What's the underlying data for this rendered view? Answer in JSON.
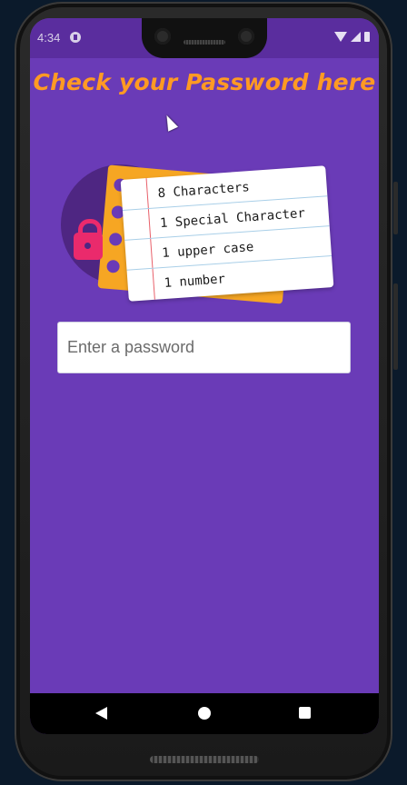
{
  "status_bar": {
    "time": "4:34",
    "app_icon": "app-notification-icon",
    "icons": [
      "wifi-icon",
      "signal-icon",
      "battery-icon"
    ]
  },
  "header": {
    "title": "Check your Password here"
  },
  "illustration": {
    "requirements": [
      "8 Characters",
      "1 Special Character",
      "1 upper case",
      "1 number"
    ]
  },
  "password_field": {
    "placeholder": "Enter a password",
    "value": ""
  },
  "nav_bar": {
    "icons": [
      "back-icon",
      "home-icon",
      "recents-icon"
    ]
  },
  "colors": {
    "background": "#6a3bb7",
    "status_bar": "#5a2d9e",
    "title": "#ff9a23",
    "illustration_circle": "#4e2682",
    "padlock": "#ea2a6c",
    "card_orange": "#f6a623",
    "input_background": "#ffffff",
    "nav_bar": "#000000"
  }
}
